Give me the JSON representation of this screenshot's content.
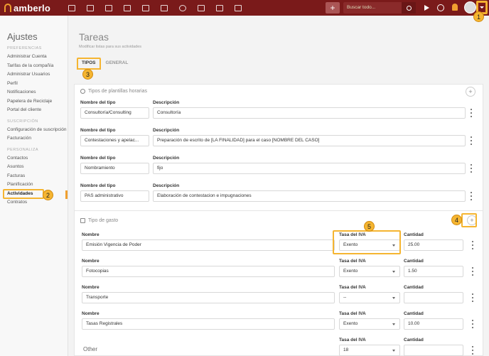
{
  "topbar": {
    "logo": "amberlo",
    "search_placeholder": "Buscar todo...",
    "plus_label": "+",
    "nav_icons": [
      "dashboard-icon",
      "contacts-icon",
      "briefcase-icon",
      "invoice-icon",
      "bank-icon",
      "calendar-icon",
      "clock-icon",
      "folder-icon",
      "document-icon",
      "mail-icon"
    ]
  },
  "callouts": [
    "1",
    "2",
    "3",
    "4",
    "5"
  ],
  "sidebar": {
    "title": "Ajustes",
    "sections": [
      {
        "heading": "PREFERENCIAS",
        "items": [
          "Administrar Cuenta",
          "Tarifas de la compañía",
          "Administrar Usuarios",
          "Perfil",
          "Notificaciones",
          "Papelera de Reciclaje",
          "Portal del cliente"
        ]
      },
      {
        "heading": "SUSCRIPCIÓN",
        "items": [
          "Configuración de suscripción",
          "Facturación"
        ]
      },
      {
        "heading": "PERSONALIZA",
        "items": [
          "Contactos",
          "Asuntos",
          "Facturas",
          "Planificación",
          "Actividades",
          "Contratos"
        ]
      }
    ],
    "active": "Actividades"
  },
  "page": {
    "title": "Tareas",
    "subtitle": "Modificar listas para sus actividades",
    "tabs": [
      "TIPOS",
      "GENERAL"
    ],
    "active_tab": "TIPOS"
  },
  "plantillas": {
    "title": "Tipos de plantillas horarias",
    "name_label": "Nombre del tipo",
    "desc_label": "Descripción",
    "rows": [
      {
        "name": "Consultoría/Consulting",
        "desc": "Consultoría"
      },
      {
        "name": "Contestaciones y apelac...",
        "desc": "Preparación de escrito de [LA FINALIDAD] para el caso [NOMBRE DEL CASO]"
      },
      {
        "name": "Nombramiento",
        "desc": "fijo"
      },
      {
        "name": "PAS administrativo",
        "desc": "Elaboración de contestacion e impugnaciones"
      }
    ]
  },
  "gasto": {
    "title": "Tipo de gasto",
    "name_label": "Nombre",
    "iva_label": "Tasa del IVA",
    "qty_label": "Cantidad",
    "rows": [
      {
        "name": "Emisión Vigencia de Poder",
        "iva": "Exento",
        "qty": "25.00"
      },
      {
        "name": "Fotocopias",
        "iva": "Exento",
        "qty": "1.50"
      },
      {
        "name": "Transporte",
        "iva": "--",
        "qty": ""
      },
      {
        "name": "Tasas Registrales",
        "iva": "Exento",
        "qty": "10.00"
      }
    ],
    "other_label": "Other",
    "other_iva": "18"
  }
}
